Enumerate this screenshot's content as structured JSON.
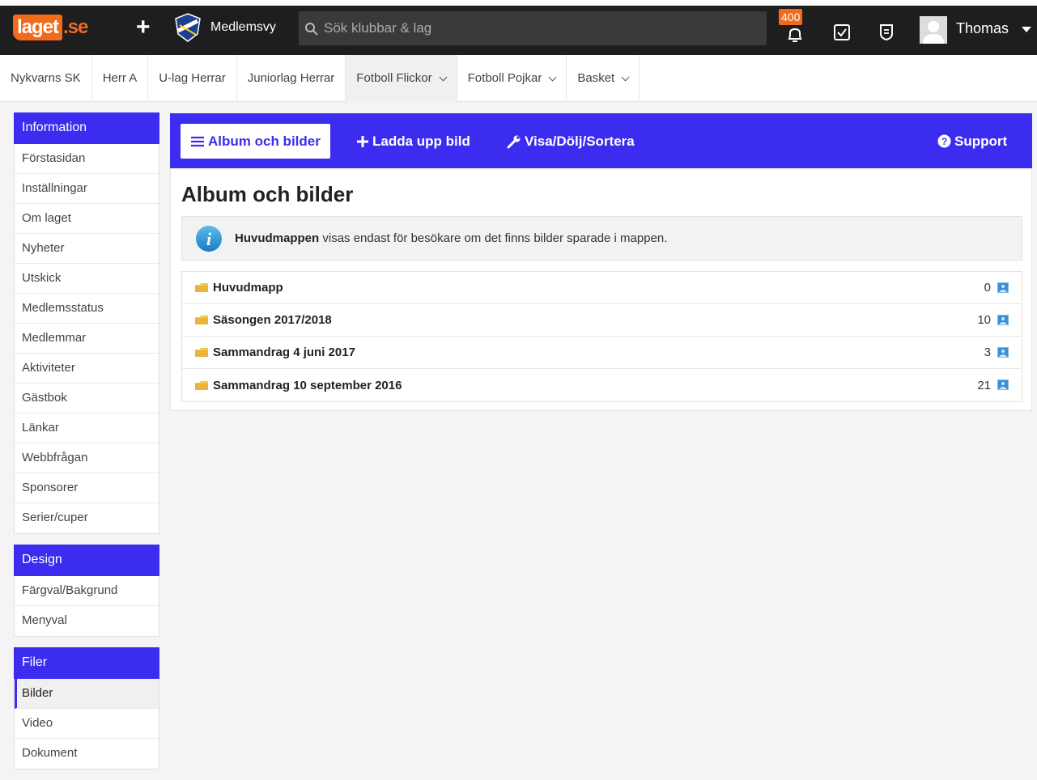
{
  "topbar": {
    "logo_main": "laget",
    "logo_tld": ".se",
    "member_view": "Medlemsvy",
    "search_placeholder": "Sök klubbar & lag",
    "notification_count": "400",
    "username": "Thomas",
    "colors": {
      "bar": "#1e1e1e",
      "brand": "#f26b1d"
    }
  },
  "teamnav": {
    "tabs": [
      {
        "label": "Nykvarns SK"
      },
      {
        "label": "Herr A"
      },
      {
        "label": "U-lag Herrar"
      },
      {
        "label": "Juniorlag Herrar"
      },
      {
        "label": "Fotboll Flickor"
      },
      {
        "label": "Fotboll Pojkar"
      },
      {
        "label": "Basket"
      }
    ]
  },
  "sidebar": {
    "information": {
      "heading": "Information",
      "items": [
        "Förstasidan",
        "Inställningar",
        "Om laget",
        "Nyheter",
        "Utskick",
        "Medlemsstatus",
        "Medlemmar",
        "Aktiviteter",
        "Gästbok",
        "Länkar",
        "Webbfrågan",
        "Sponsorer",
        "Serier/cuper"
      ]
    },
    "design": {
      "heading": "Design",
      "items": [
        "Färgval/Bakgrund",
        "Menyval"
      ]
    },
    "filer": {
      "heading": "Filer",
      "items": [
        "Bilder",
        "Video",
        "Dokument"
      ]
    }
  },
  "toolbar": {
    "album": "Album och bilder",
    "upload": "Ladda upp bild",
    "sort": "Visa/Dölj/Sortera",
    "support": "Support",
    "color": "#3c2cf0"
  },
  "main": {
    "title": "Album och bilder",
    "info_bold": "Huvudmappen",
    "info_rest": " visas endast för besökare om det finns bilder sparade i mappen."
  },
  "albums": [
    {
      "name": "Huvudmapp",
      "count": "0"
    },
    {
      "name": "Säsongen 2017/2018",
      "count": "10"
    },
    {
      "name": "Sammandrag 4 juni 2017",
      "count": "3"
    },
    {
      "name": "Sammandrag 10 september 2016",
      "count": "21"
    }
  ]
}
